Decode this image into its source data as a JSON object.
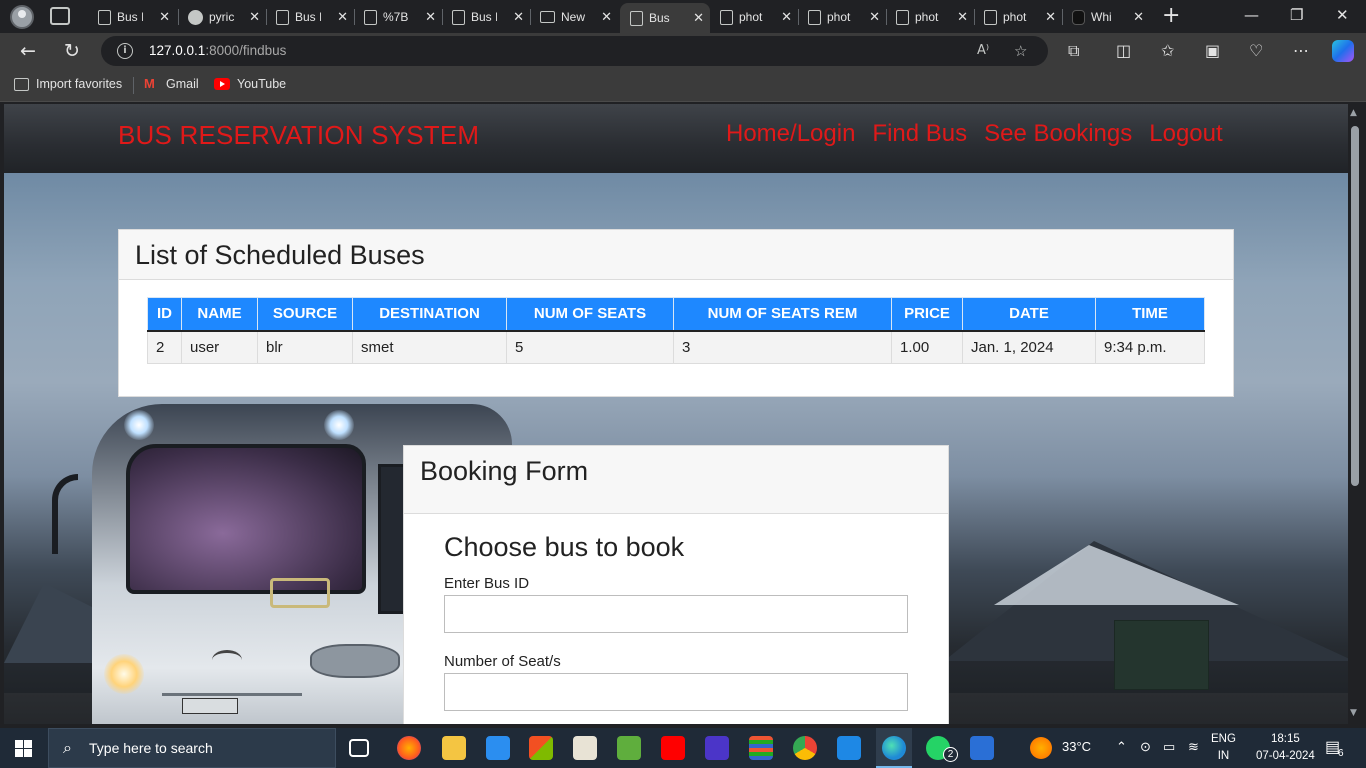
{
  "browser": {
    "tabs": [
      {
        "label": "Bus I",
        "icon": "document-icon"
      },
      {
        "label": "pyric",
        "icon": "github-icon"
      },
      {
        "label": "Bus I",
        "icon": "document-icon"
      },
      {
        "label": "%7B",
        "icon": "document-icon"
      },
      {
        "label": "Bus I",
        "icon": "document-icon"
      },
      {
        "label": "New",
        "icon": "news-icon"
      },
      {
        "label": "Bus",
        "icon": "document-icon",
        "active": true
      },
      {
        "label": "phot",
        "icon": "document-icon"
      },
      {
        "label": "phot",
        "icon": "document-icon"
      },
      {
        "label": "phot",
        "icon": "document-icon"
      },
      {
        "label": "phot",
        "icon": "document-icon"
      },
      {
        "label": "Whi",
        "icon": "app-icon"
      }
    ],
    "url_host": "127.0.0.1",
    "url_path": ":8000/findbus",
    "favorites": [
      {
        "label": "Import favorites",
        "icon": "import-icon"
      },
      {
        "label": "Gmail",
        "icon": "gmail-icon"
      },
      {
        "label": "YouTube",
        "icon": "youtube-icon"
      }
    ]
  },
  "site": {
    "brand": "BUS RESERVATION SYSTEM",
    "nav": [
      "Home/Login",
      "Find Bus",
      "See Bookings",
      "Logout"
    ],
    "brand_color": "#e01919"
  },
  "schedule": {
    "title": "List of Scheduled Buses",
    "columns": [
      "ID",
      "NAME",
      "SOURCE",
      "DESTINATION",
      "NUM OF SEATS",
      "NUM OF SEATS REM",
      "PRICE",
      "DATE",
      "TIME"
    ],
    "rows": [
      [
        "2",
        "user",
        "blr",
        "smet",
        "5",
        "3",
        "1.00",
        "Jan. 1, 2024",
        "9:34 p.m."
      ]
    ],
    "header_color": "#1e88ff"
  },
  "booking": {
    "title": "Booking Form",
    "subtitle": "Choose bus to book",
    "bus_id_label": "Enter Bus ID",
    "bus_id_value": "",
    "seats_label": "Number of Seat/s",
    "seats_value": ""
  },
  "taskbar": {
    "search_placeholder": "Type here to search",
    "weather": "33°C",
    "lang_top": "ENG",
    "lang_bottom": "IN",
    "time": "18:15",
    "date": "07-04-2024",
    "whatsapp_badge": "2",
    "notification_count": "6"
  }
}
